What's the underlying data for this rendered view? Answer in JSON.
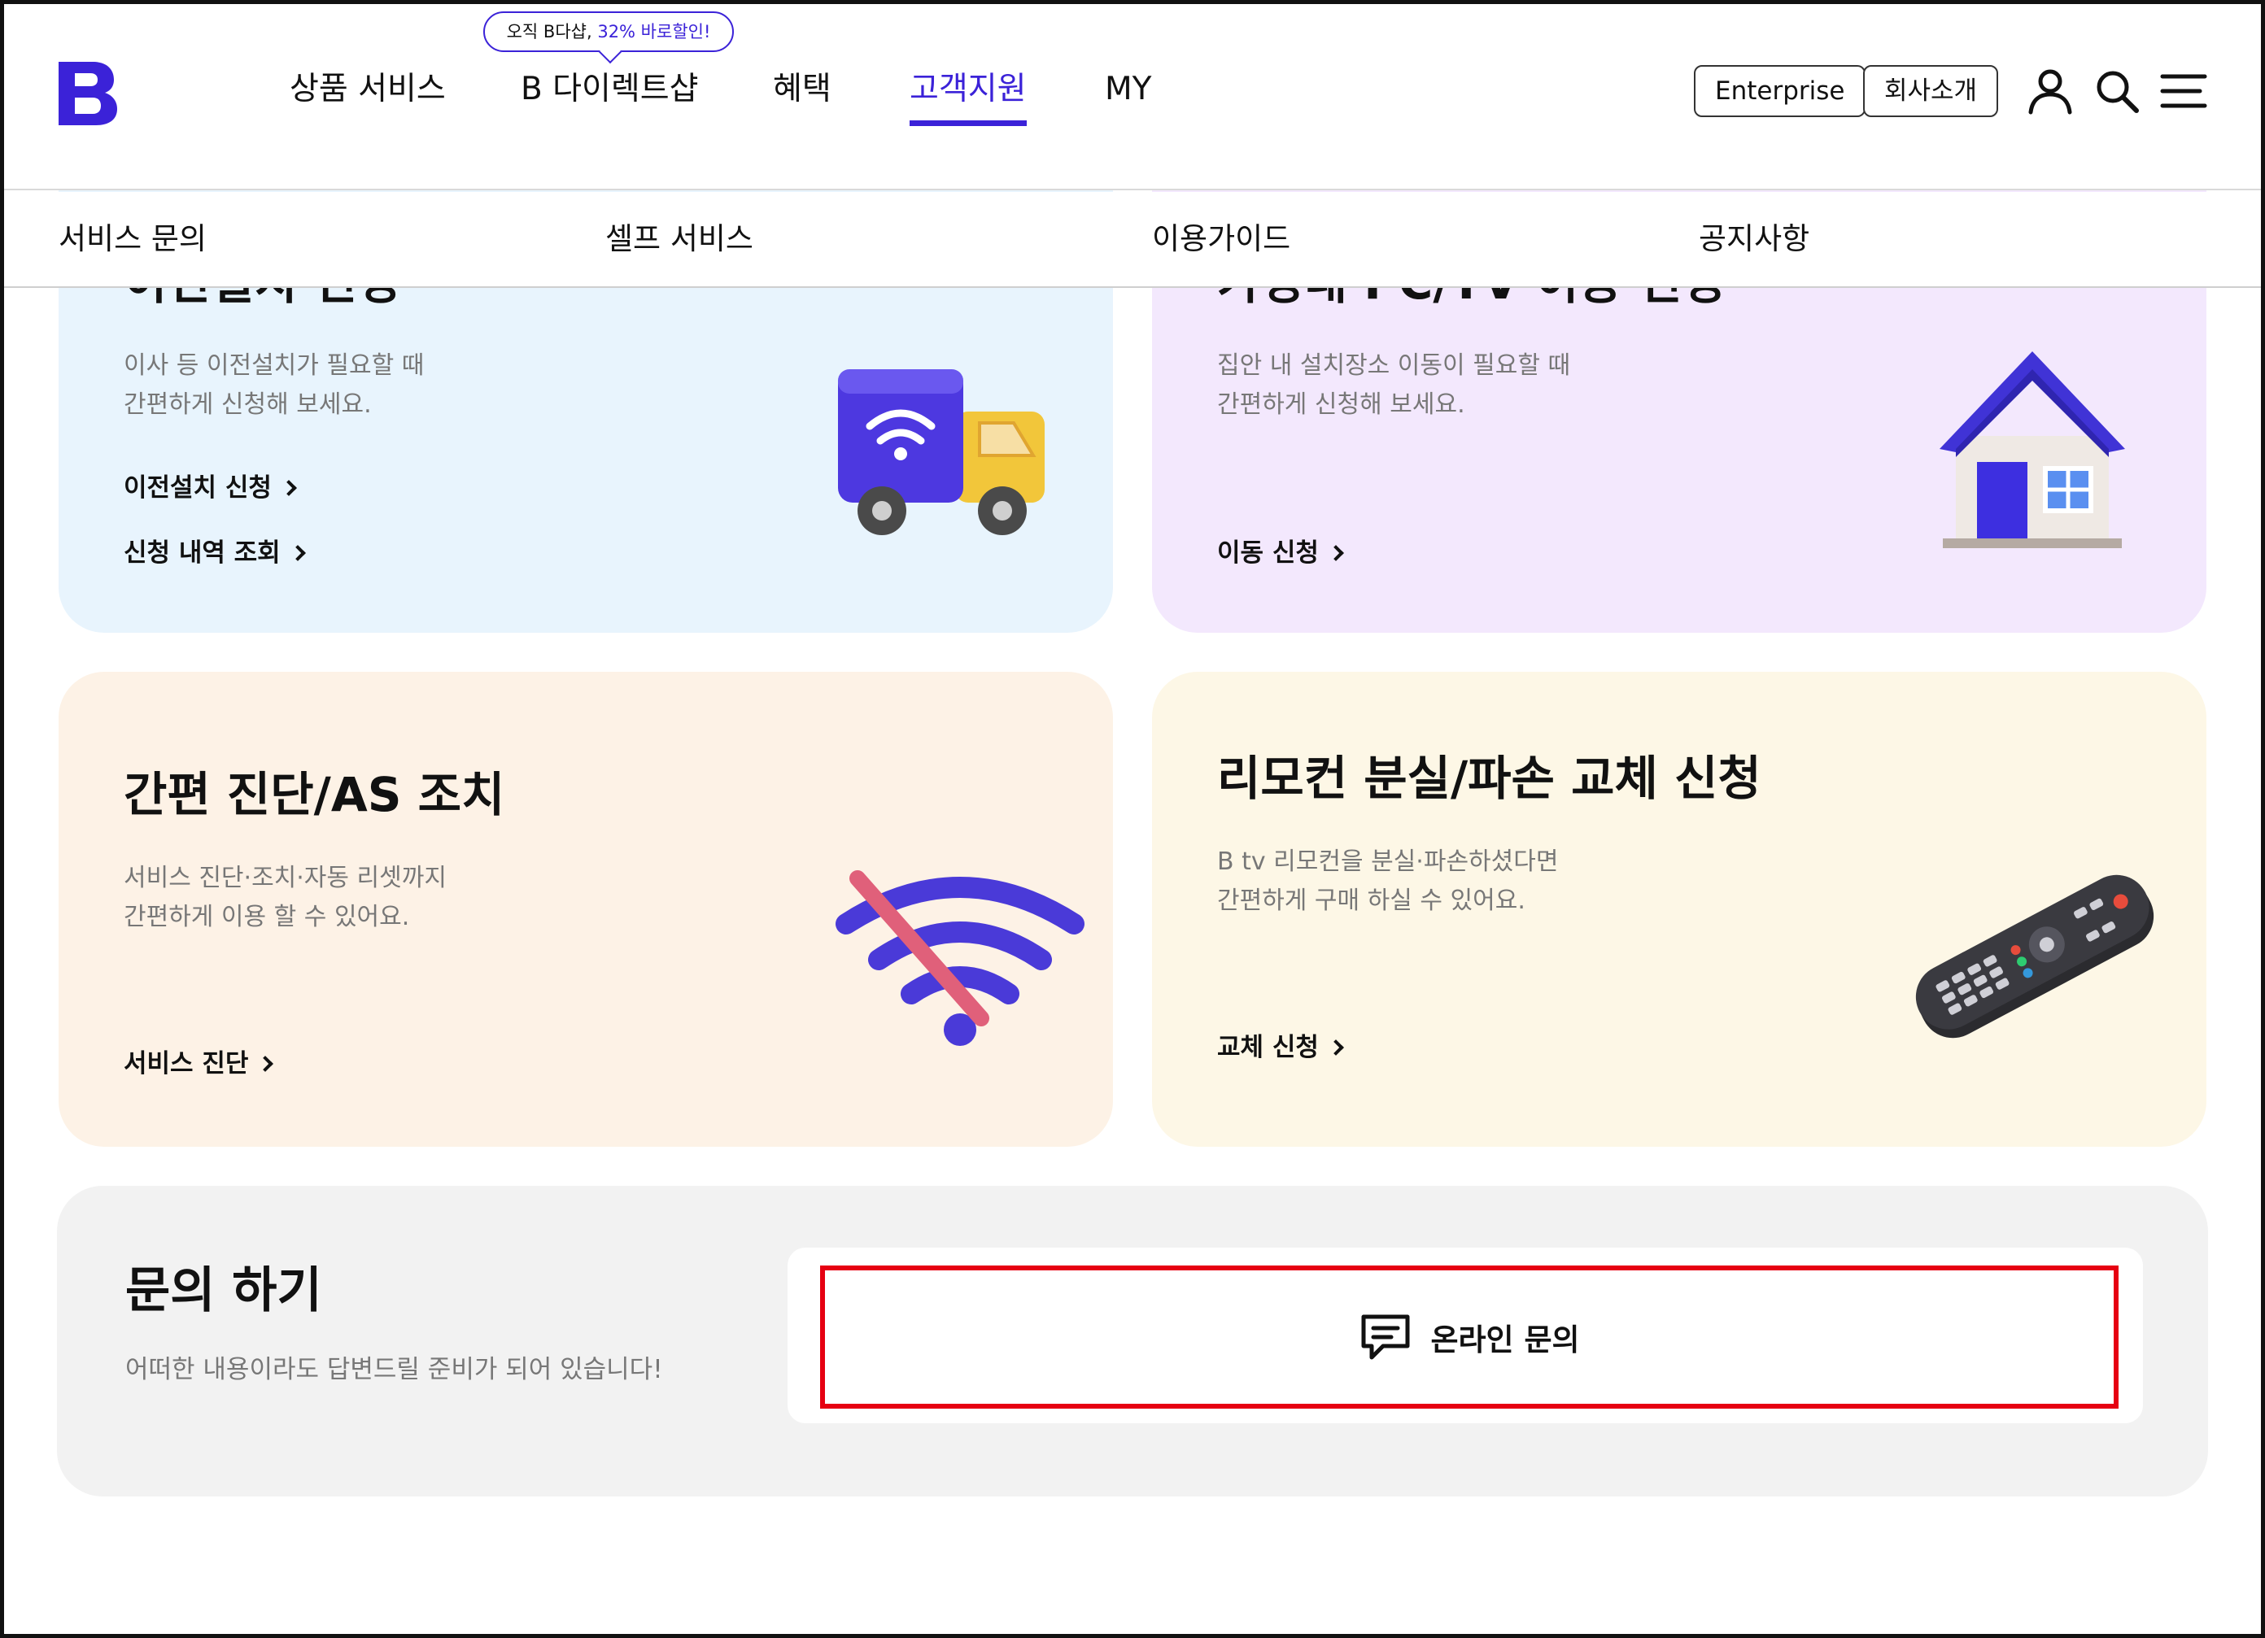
{
  "brand": {
    "logo_letter": "B",
    "accent": "#3b22d8"
  },
  "header": {
    "promo": {
      "prefix": "오직 B다샵, ",
      "highlight": "32% 바로할인!"
    },
    "nav": [
      {
        "label": "상품 서비스"
      },
      {
        "label": "B 다이렉트샵"
      },
      {
        "label": "혜택"
      },
      {
        "label": "고객지원",
        "active": true
      },
      {
        "label": "MY"
      }
    ],
    "buttons": {
      "enterprise": "Enterprise",
      "company": "회사소개"
    },
    "icons": [
      "user-icon",
      "search-icon",
      "menu-icon"
    ]
  },
  "subnav": {
    "items": [
      {
        "label": "서비스 문의"
      },
      {
        "label": "셀프 서비스"
      },
      {
        "label": "이용가이드"
      },
      {
        "label": "공지사항"
      }
    ]
  },
  "cards": {
    "relocation": {
      "title": "이전설치 신청",
      "desc_1": "이사 등 이전설치가 필요할 때",
      "desc_2": "간편하게 신청해 보세요.",
      "link_1": "이전설치 신청",
      "link_2": "신청 내역 조회",
      "icon": "truck-icon",
      "bg": "#e8f4fd"
    },
    "move": {
      "title": "가정내 PC/TV 이동 신청",
      "desc_1": "집안 내 설치장소 이동이 필요할 때",
      "desc_2": "간편하게 신청해 보세요.",
      "link_1": "이동 신청",
      "icon": "house-icon",
      "bg": "#f3e8fd"
    },
    "diagnosis": {
      "title": "간편 진단/AS 조치",
      "desc_1": "서비스 진단·조치·자동 리셋까지",
      "desc_2": "간편하게 이용 할 수 있어요.",
      "link_1": "서비스 진단",
      "icon": "wifi-off-icon",
      "bg": "#fdf2e6"
    },
    "remote": {
      "title": "리모컨 분실/파손 교체 신청",
      "desc_1": "B tv 리모컨을 분실·파손하셨다면",
      "desc_2": "간편하게 구매 하실 수 있어요.",
      "link_1": "교체 신청",
      "icon": "remote-control-icon",
      "bg": "#fdf7e6"
    }
  },
  "inquiry": {
    "title": "문의 하기",
    "desc": "어떠한 내용이라도 답변드릴 준비가 되어 있습니다!",
    "online_label": "온라인 문의",
    "icon": "chat-icon"
  }
}
